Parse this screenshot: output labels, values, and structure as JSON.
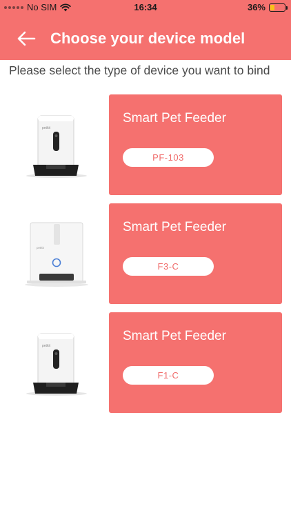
{
  "status_bar": {
    "carrier": "No SIM",
    "time": "16:34",
    "battery_percent": "36%",
    "battery_level": 0.36
  },
  "header": {
    "title": "Choose your device model",
    "back_icon": "arrow-left-icon"
  },
  "instruction": "Please select the type of device you want to bind",
  "devices": [
    {
      "name": "Smart Pet Feeder",
      "model": "PF-103"
    },
    {
      "name": "Smart Pet Feeder",
      "model": "F3-C"
    },
    {
      "name": "Smart Pet Feeder",
      "model": "F1-C"
    }
  ],
  "colors": {
    "accent": "#f5716f",
    "battery": "#f8c11a",
    "text": "#4a4a4a"
  }
}
